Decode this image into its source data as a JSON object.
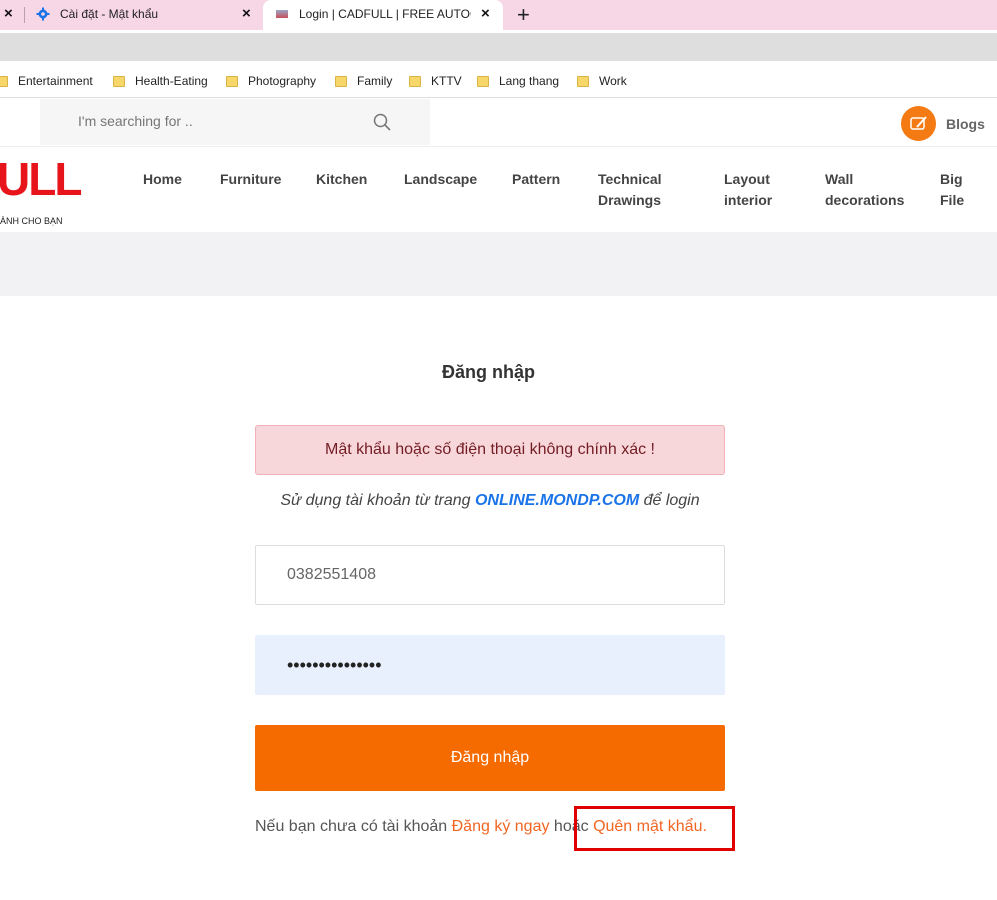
{
  "browser": {
    "tabs": [
      {
        "title": "Cài đặt - Mật khẩu",
        "icon": "gear-icon"
      },
      {
        "title": "Login | CADFULL | FREE AUTOCAD",
        "icon": "site-favicon"
      }
    ],
    "new_tab_symbol": "+",
    "close_symbol": "×",
    "bookmarks": [
      "Entertainment",
      "Health-Eating",
      "Photography",
      "Family",
      "KTTV",
      "Lang thang",
      "Work"
    ]
  },
  "header": {
    "search_placeholder": "I'm searching for ..",
    "blogs_label": "Blogs",
    "logo_text": "ULL",
    "logo_sub": "ÀNH CHO BẠN"
  },
  "nav": {
    "items": [
      {
        "line1": "Home",
        "line2": ""
      },
      {
        "line1": "Furniture",
        "line2": ""
      },
      {
        "line1": "Kitchen",
        "line2": ""
      },
      {
        "line1": "Landscape",
        "line2": ""
      },
      {
        "line1": "Pattern",
        "line2": ""
      },
      {
        "line1": "Technical",
        "line2": "Drawings"
      },
      {
        "line1": "Layout",
        "line2": "interior"
      },
      {
        "line1": "Wall",
        "line2": "decorations"
      },
      {
        "line1": "Big",
        "line2": "File"
      }
    ]
  },
  "login": {
    "title": "Đăng nhập",
    "error": "Mật khẩu hoặc số điện thoại không chính xác !",
    "hint_prefix": "Sử dụng tài khoản từ trang ",
    "hint_link": "ONLINE.MONDP.COM",
    "hint_suffix": " để login",
    "phone_value": "0382551408",
    "password_value": "•••••••••••••••",
    "submit_label": "Đăng nhập",
    "footer_prefix": "Nếu bạn chưa có tài khoản ",
    "register_link": "Đăng ký ngay",
    "footer_or": " hoặc ",
    "forgot_link": "Quên mật khẩu."
  },
  "colors": {
    "accent": "#f56b00",
    "highlight_box": "#e00000",
    "tabstrip": "#f7d6e6"
  }
}
